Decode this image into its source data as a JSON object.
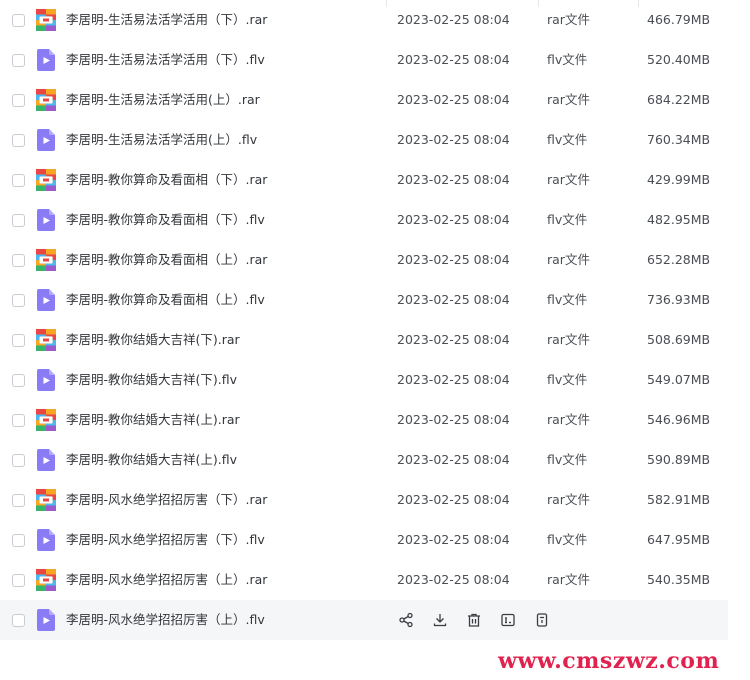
{
  "files": [
    {
      "name": "李居明-生活易法活学活用（下）.rar",
      "date": "2023-02-25 08:04",
      "type": "rar文件",
      "size": "466.79MB",
      "icon": "rar-archive-icon"
    },
    {
      "name": "李居明-生活易法活学活用（下）.flv",
      "date": "2023-02-25 08:04",
      "type": "flv文件",
      "size": "520.40MB",
      "icon": "video-file-icon"
    },
    {
      "name": "李居明-生活易法活学活用(上）.rar",
      "date": "2023-02-25 08:04",
      "type": "rar文件",
      "size": "684.22MB",
      "icon": "rar-archive-icon"
    },
    {
      "name": "李居明-生活易法活学活用(上）.flv",
      "date": "2023-02-25 08:04",
      "type": "flv文件",
      "size": "760.34MB",
      "icon": "video-file-icon"
    },
    {
      "name": "李居明-教你算命及看面相（下）.rar",
      "date": "2023-02-25 08:04",
      "type": "rar文件",
      "size": "429.99MB",
      "icon": "rar-archive-icon"
    },
    {
      "name": "李居明-教你算命及看面相（下）.flv",
      "date": "2023-02-25 08:04",
      "type": "flv文件",
      "size": "482.95MB",
      "icon": "video-file-icon"
    },
    {
      "name": "李居明-教你算命及看面相（上）.rar",
      "date": "2023-02-25 08:04",
      "type": "rar文件",
      "size": "652.28MB",
      "icon": "rar-archive-icon"
    },
    {
      "name": "李居明-教你算命及看面相（上）.flv",
      "date": "2023-02-25 08:04",
      "type": "flv文件",
      "size": "736.93MB",
      "icon": "video-file-icon"
    },
    {
      "name": "李居明-教你结婚大吉祥(下).rar",
      "date": "2023-02-25 08:04",
      "type": "rar文件",
      "size": "508.69MB",
      "icon": "rar-archive-icon"
    },
    {
      "name": "李居明-教你结婚大吉祥(下).flv",
      "date": "2023-02-25 08:04",
      "type": "flv文件",
      "size": "549.07MB",
      "icon": "video-file-icon"
    },
    {
      "name": "李居明-教你结婚大吉祥(上).rar",
      "date": "2023-02-25 08:04",
      "type": "rar文件",
      "size": "546.96MB",
      "icon": "rar-archive-icon"
    },
    {
      "name": "李居明-教你结婚大吉祥(上).flv",
      "date": "2023-02-25 08:04",
      "type": "flv文件",
      "size": "590.89MB",
      "icon": "video-file-icon"
    },
    {
      "name": "李居明-风水绝学招招厉害（下）.rar",
      "date": "2023-02-25 08:04",
      "type": "rar文件",
      "size": "582.91MB",
      "icon": "rar-archive-icon"
    },
    {
      "name": "李居明-风水绝学招招厉害（下）.flv",
      "date": "2023-02-25 08:04",
      "type": "flv文件",
      "size": "647.95MB",
      "icon": "video-file-icon"
    },
    {
      "name": "李居明-风水绝学招招厉害（上）.rar",
      "date": "2023-02-25 08:04",
      "type": "rar文件",
      "size": "540.35MB",
      "icon": "rar-archive-icon"
    },
    {
      "name": "李居明-风水绝学招招厉害（上）.flv",
      "date": "2023-02-25 08:04",
      "type": "flv文件",
      "size": "",
      "icon": "video-file-icon",
      "hovered": true
    }
  ],
  "hover_actions": [
    {
      "name": "share-icon"
    },
    {
      "name": "download-icon"
    },
    {
      "name": "delete-icon"
    },
    {
      "name": "rename-icon"
    },
    {
      "name": "more-icon"
    }
  ],
  "watermark": "www.cmszwz.com",
  "colors": {
    "text": "#33363b",
    "muted_text": "#4a4e55",
    "row_hover": "#f5f6f8",
    "video_icon": "#8a7cf6",
    "watermark": "#e0234e"
  }
}
